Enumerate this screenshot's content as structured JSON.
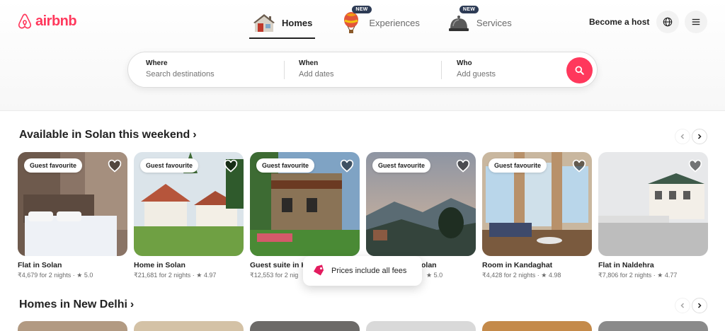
{
  "brand": {
    "name": "airbnb",
    "color": "#ff385c"
  },
  "nav": {
    "homes": "Homes",
    "experiences": "Experiences",
    "services": "Services",
    "new_badge": "NEW"
  },
  "header": {
    "become_host": "Become a host",
    "globe_icon": "globe-icon",
    "menu_icon": "hamburger-menu-icon"
  },
  "search": {
    "where_title": "Where",
    "where_placeholder": "Search destinations",
    "when_title": "When",
    "when_placeholder": "Add dates",
    "who_title": "Who",
    "who_placeholder": "Add guests"
  },
  "section1": {
    "title": "Available in Solan this weekend",
    "chevron": "›",
    "cards": [
      {
        "badge": "Guest favourite",
        "title": "Flat in Solan",
        "sub": "₹4,679 for 2 nights · ★ 5.0"
      },
      {
        "badge": "Guest favourite",
        "title": "Home in Solan",
        "sub": "₹21,681 for 2 nights · ★ 4.97"
      },
      {
        "badge": "Guest favourite",
        "title": "Guest suite in K",
        "sub": "₹12,553 for 2 nig"
      },
      {
        "badge": "Guest favourite",
        "title": "olan",
        "sub": "★ 5.0"
      },
      {
        "badge": "Guest favourite",
        "title": "Room in Kandaghat",
        "sub": "₹4,428 for 2 nights · ★ 4.98"
      },
      {
        "badge": "",
        "title": "Flat in Naldehra",
        "sub": "₹7,806 for 2 nights · ★ 4.77"
      }
    ]
  },
  "toast": {
    "text": "Prices include all fees"
  },
  "section2": {
    "title": "Homes in New Delhi",
    "chevron": "›"
  }
}
